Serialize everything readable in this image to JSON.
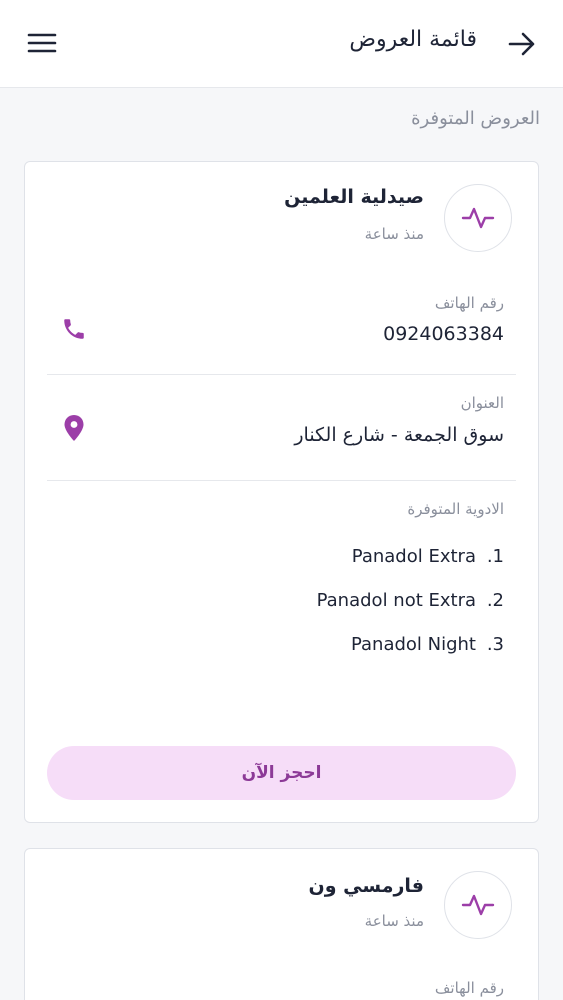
{
  "header": {
    "title": "قائمة العروض",
    "back_icon": "arrow-right-icon",
    "menu_icon": "hamburger-menu-icon"
  },
  "section": {
    "title": "العروض المتوفرة"
  },
  "colors": {
    "accent": "#9c3ea8",
    "button_bg": "#f6ddf8",
    "button_text": "#8c3a97",
    "muted_text": "#8a8f9c",
    "primary_text": "#1e2436"
  },
  "offers": [
    {
      "name": "صيدلية العلمين",
      "time": "منذ ساعة",
      "icon": "activity-pulse-icon",
      "phone_label": "رقم الهاتف",
      "phone": "0924063384",
      "address_label": "العنوان",
      "address": "سوق الجمعة - شارع الكنار",
      "meds_label": "الادوية المتوفرة",
      "medicines": [
        {
          "num": ".1",
          "name": "Panadol Extra"
        },
        {
          "num": ".2",
          "name": "Panadol not Extra"
        },
        {
          "num": ".3",
          "name": "Panadol Night"
        }
      ],
      "book_label": "احجز الآن"
    },
    {
      "name": "فارمسي ون",
      "time": "منذ ساعة",
      "icon": "activity-pulse-icon",
      "phone_label": "رقم الهاتف"
    }
  ]
}
